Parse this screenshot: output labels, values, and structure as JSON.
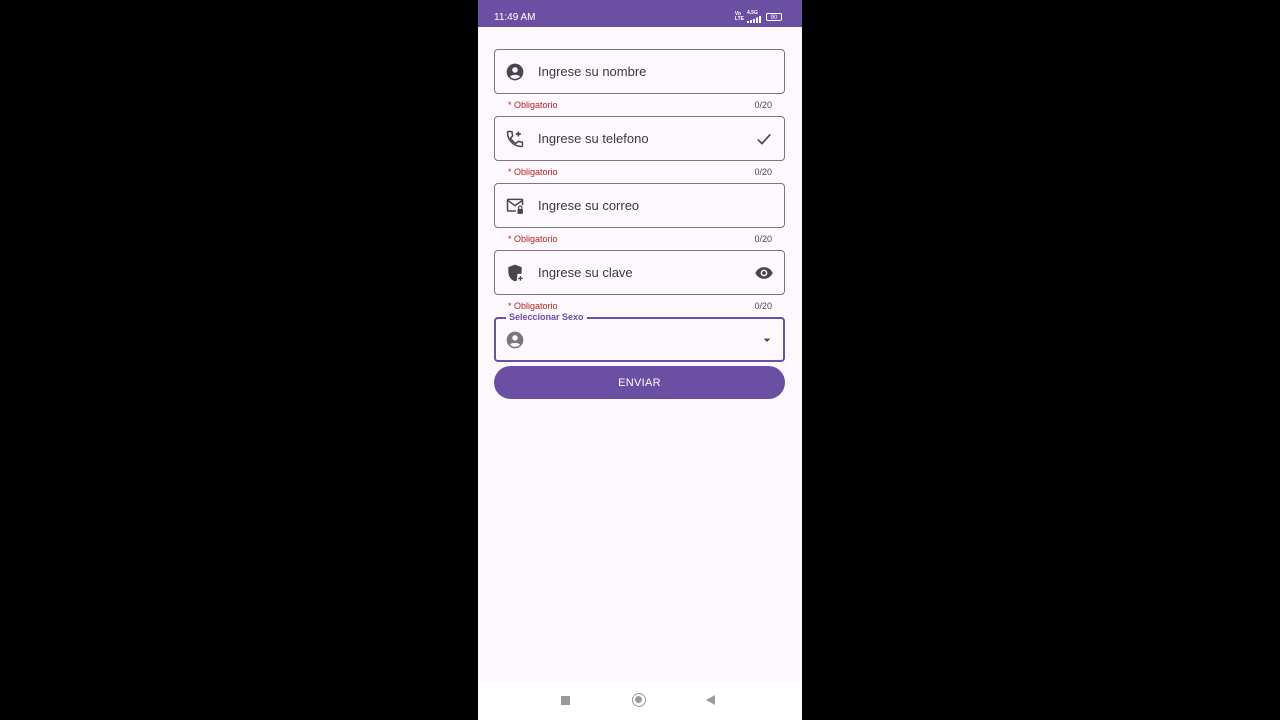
{
  "status_bar": {
    "time": "11:49 AM",
    "network_top": "Vo",
    "network_bottom": "LTE",
    "network_gen": "4.5G",
    "battery": "90"
  },
  "form": {
    "fields": [
      {
        "placeholder": "Ingrese su nombre",
        "helper": "* Obligatorio",
        "counter": "0/20",
        "icon": "account-circle-icon"
      },
      {
        "placeholder": "Ingrese su telefono",
        "helper": "* Obligatorio",
        "counter": "0/20",
        "icon": "add-call-icon",
        "trailing_icon": "check-icon"
      },
      {
        "placeholder": "Ingrese su correo",
        "helper": "* Obligatorio",
        "counter": "0/20",
        "icon": "mail-lock-icon"
      },
      {
        "placeholder": "Ingrese su clave",
        "helper": "* Obligatorio",
        "counter": "0/20",
        "icon": "shield-add-icon",
        "trailing_icon": "eye-icon"
      }
    ],
    "select": {
      "label": "Seleccionar Sexo",
      "value": "",
      "icon": "account-circle-icon"
    },
    "submit_label": "ENVIAR"
  },
  "colors": {
    "primary": "#6a4fa2",
    "background": "#fdf7fe",
    "error": "#b3261e",
    "outline": "#7a757f"
  }
}
